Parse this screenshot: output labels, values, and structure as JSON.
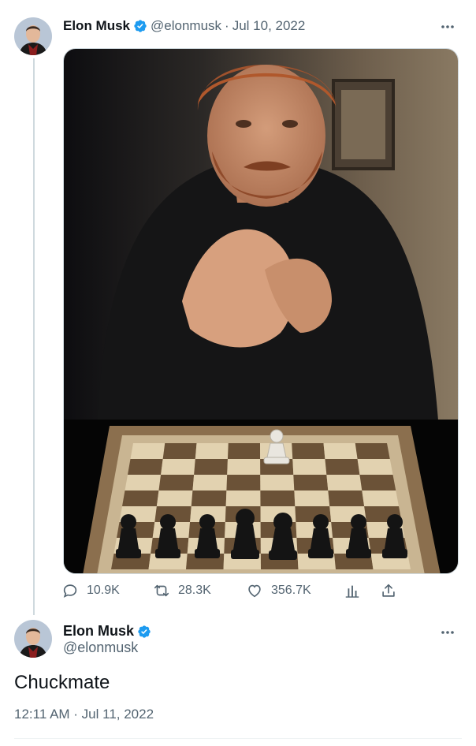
{
  "original_tweet": {
    "author_name": "Elon Musk",
    "handle": "@elonmusk",
    "separator": "·",
    "date": "Jul 10, 2022",
    "media_alt": "Photo of a man with red hair and beard resting his chin on clasped hands behind a chessboard",
    "actions": {
      "replies": "10.9K",
      "retweets": "28.3K",
      "likes": "356.7K"
    }
  },
  "reply_tweet": {
    "author_name": "Elon Musk",
    "handle": "@elonmusk",
    "text": "Chuckmate",
    "timestamp": "12:11 AM · Jul 11, 2022"
  },
  "colors": {
    "verified": "#1d9bf0",
    "secondary_text": "#536471",
    "thread_line": "#cfd9de"
  }
}
